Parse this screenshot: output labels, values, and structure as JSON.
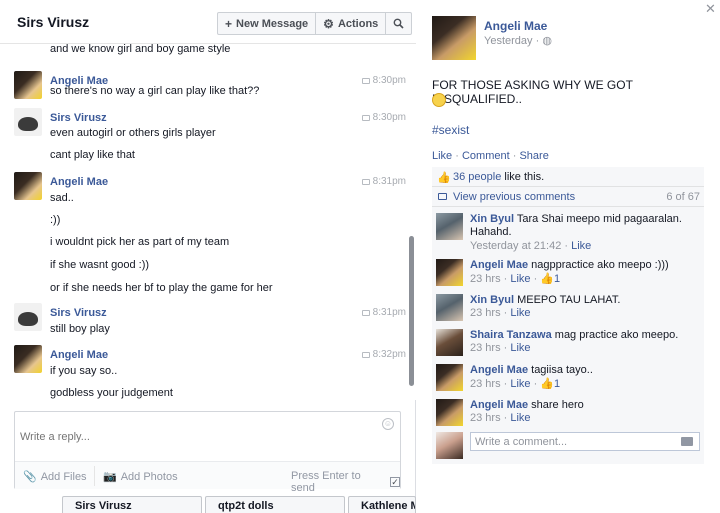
{
  "chat": {
    "title": "Sirs Virusz",
    "new_message": "New Message",
    "actions": "Actions",
    "messages": [
      {
        "kind": "line",
        "text": "and we know girl and boy game style"
      },
      {
        "kind": "sender",
        "name": "Angeli Mae",
        "time": "8:30pm"
      },
      {
        "kind": "line",
        "text": "so there's no way a girl can play like that??"
      },
      {
        "kind": "sender",
        "name": "Sirs Virusz",
        "time": "8:30pm"
      },
      {
        "kind": "line",
        "text": "even autogirl or others girls player"
      },
      {
        "kind": "line",
        "text": "cant play like that"
      },
      {
        "kind": "sender",
        "name": "Angeli Mae",
        "time": "8:31pm"
      },
      {
        "kind": "line",
        "text": "sad.."
      },
      {
        "kind": "line",
        "text": ":))"
      },
      {
        "kind": "line",
        "text": "i wouldnt pick her as part of my team"
      },
      {
        "kind": "line",
        "text": "if she wasnt good :))"
      },
      {
        "kind": "line",
        "text": "or if she needs her bf to play the game for her"
      },
      {
        "kind": "sender",
        "name": "Sirs Virusz",
        "time": "8:31pm"
      },
      {
        "kind": "line",
        "text": "still boy play"
      },
      {
        "kind": "sender",
        "name": "Angeli Mae",
        "time": "8:32pm"
      },
      {
        "kind": "line",
        "text": "if you say so.."
      },
      {
        "kind": "line",
        "text": "godbless your judgement"
      }
    ],
    "reply_placeholder": "Write a reply...",
    "add_files": "Add Files",
    "add_photos": "Add Photos",
    "press_enter": "Press Enter to send",
    "bottom_tabs": [
      "Sirs Virusz",
      "qtp2t dolls",
      "Kathlene Me"
    ]
  },
  "post": {
    "author": "Angeli Mae",
    "time": "Yesterday ·",
    "text": "FOR THOSE ASKING WHY WE GOT DISQUALIFIED..",
    "hashtag": "#sexist",
    "like": "Like",
    "comment": "Comment",
    "share": "Share",
    "likes_count": "36 people",
    "likes_suffix": "like this.",
    "view_previous": "View previous comments",
    "comments_count": "6 of 67",
    "comments": [
      {
        "name": "Xin Byul",
        "text": "Tara Shai meepo mid pagaaralan. Hahahd.",
        "time": "Yesterday at 21:42",
        "like": "Like",
        "likes": "",
        "avatar": "xin"
      },
      {
        "name": "Angeli Mae",
        "text": "nagppractice ako meepo :)))",
        "time": "23 hrs",
        "like": "Like",
        "likes": "1",
        "avatar": "ang"
      },
      {
        "name": "Xin Byul",
        "text": "MEEPO TAU LAHAT.",
        "time": "23 hrs",
        "like": "Like",
        "likes": "",
        "avatar": "xin"
      },
      {
        "name": "Shaira Tanzawa",
        "text": "mag practice ako meepo.",
        "time": "23 hrs",
        "like": "Like",
        "likes": "",
        "avatar": "sha"
      },
      {
        "name": "Angeli Mae",
        "text": "tagiisa tayo..",
        "time": "23 hrs",
        "like": "Like",
        "likes": "1",
        "avatar": "ang"
      },
      {
        "name": "Angeli Mae",
        "text": "share hero",
        "time": "23 hrs",
        "like": "Like",
        "likes": "",
        "avatar": "ang"
      }
    ],
    "write_comment": "Write a comment..."
  }
}
